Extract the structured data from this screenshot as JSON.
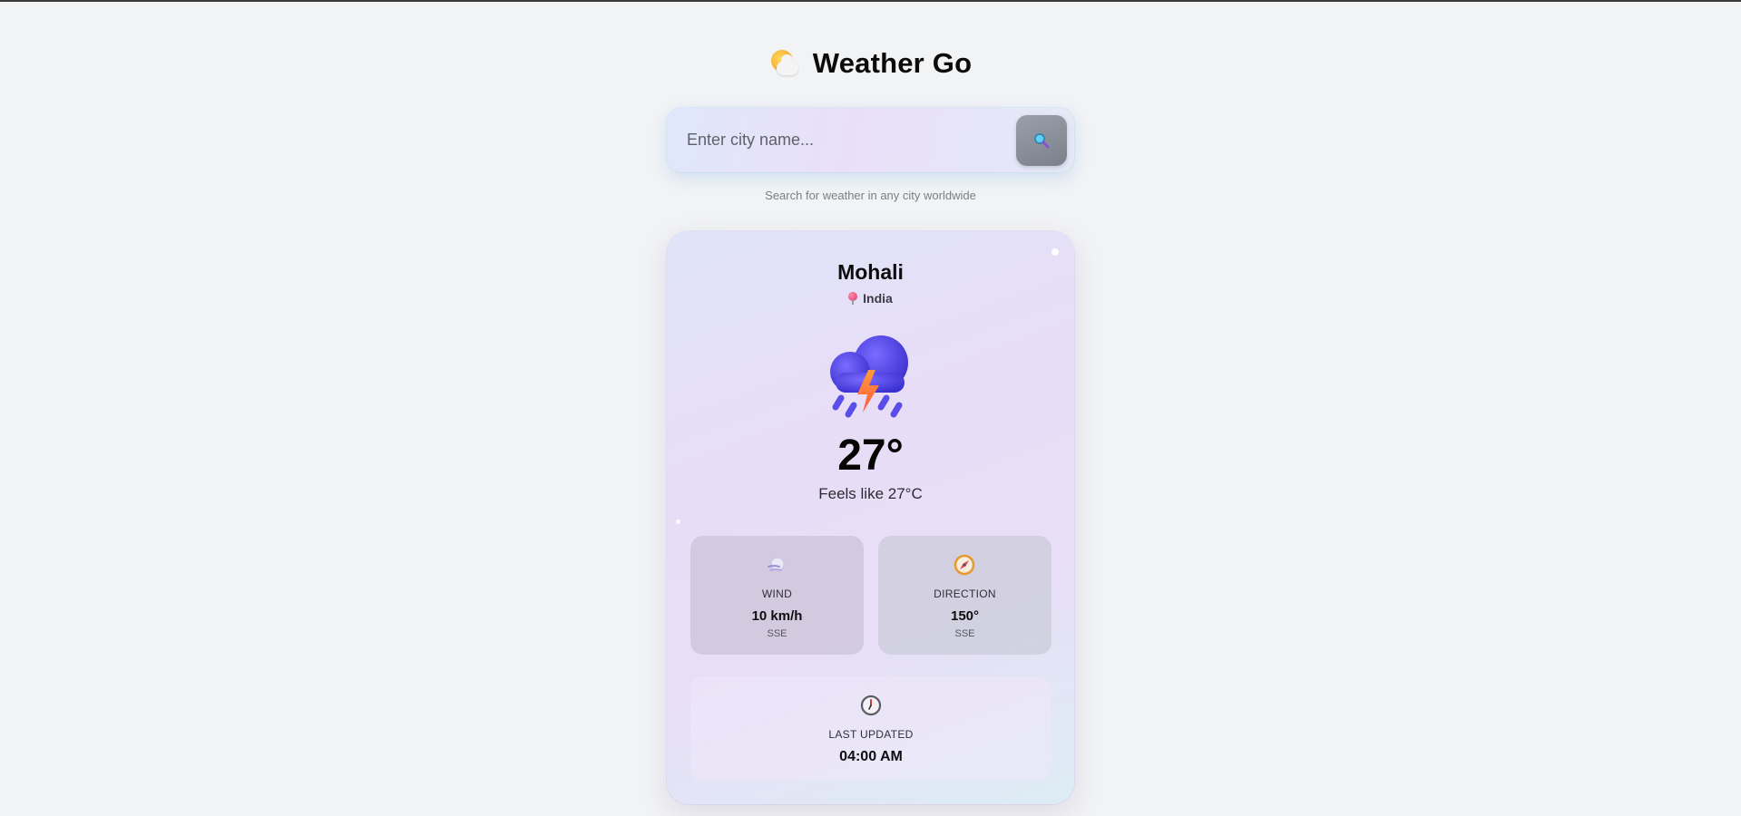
{
  "header": {
    "title": "Weather Go",
    "logo_icon": "sun-behind-cloud-icon"
  },
  "search": {
    "placeholder": "Enter city name...",
    "value": "",
    "button_icon": "magnifier-icon",
    "hint": "Search for weather in any city worldwide"
  },
  "weather": {
    "city": "Mohali",
    "country": "India",
    "condition_icon": "thunderstorm-rain-cloud-icon",
    "temperature": "27°",
    "feels_like": "Feels like 27°C"
  },
  "stats": {
    "wind": {
      "icon": "wind-icon",
      "label": "WIND",
      "value": "10 km/h",
      "sub": "SSE"
    },
    "direction": {
      "icon": "compass-icon",
      "label": "DIRECTION",
      "value": "150°",
      "sub": "SSE"
    }
  },
  "updated": {
    "icon": "clock-icon",
    "label": "LAST UPDATED",
    "value": "04:00 AM"
  },
  "colors": {
    "page_background": "#f2f3f5",
    "cloud": "#4b3fe0",
    "lightning": "#ff7a3a",
    "rain": "#5a4ee8"
  }
}
